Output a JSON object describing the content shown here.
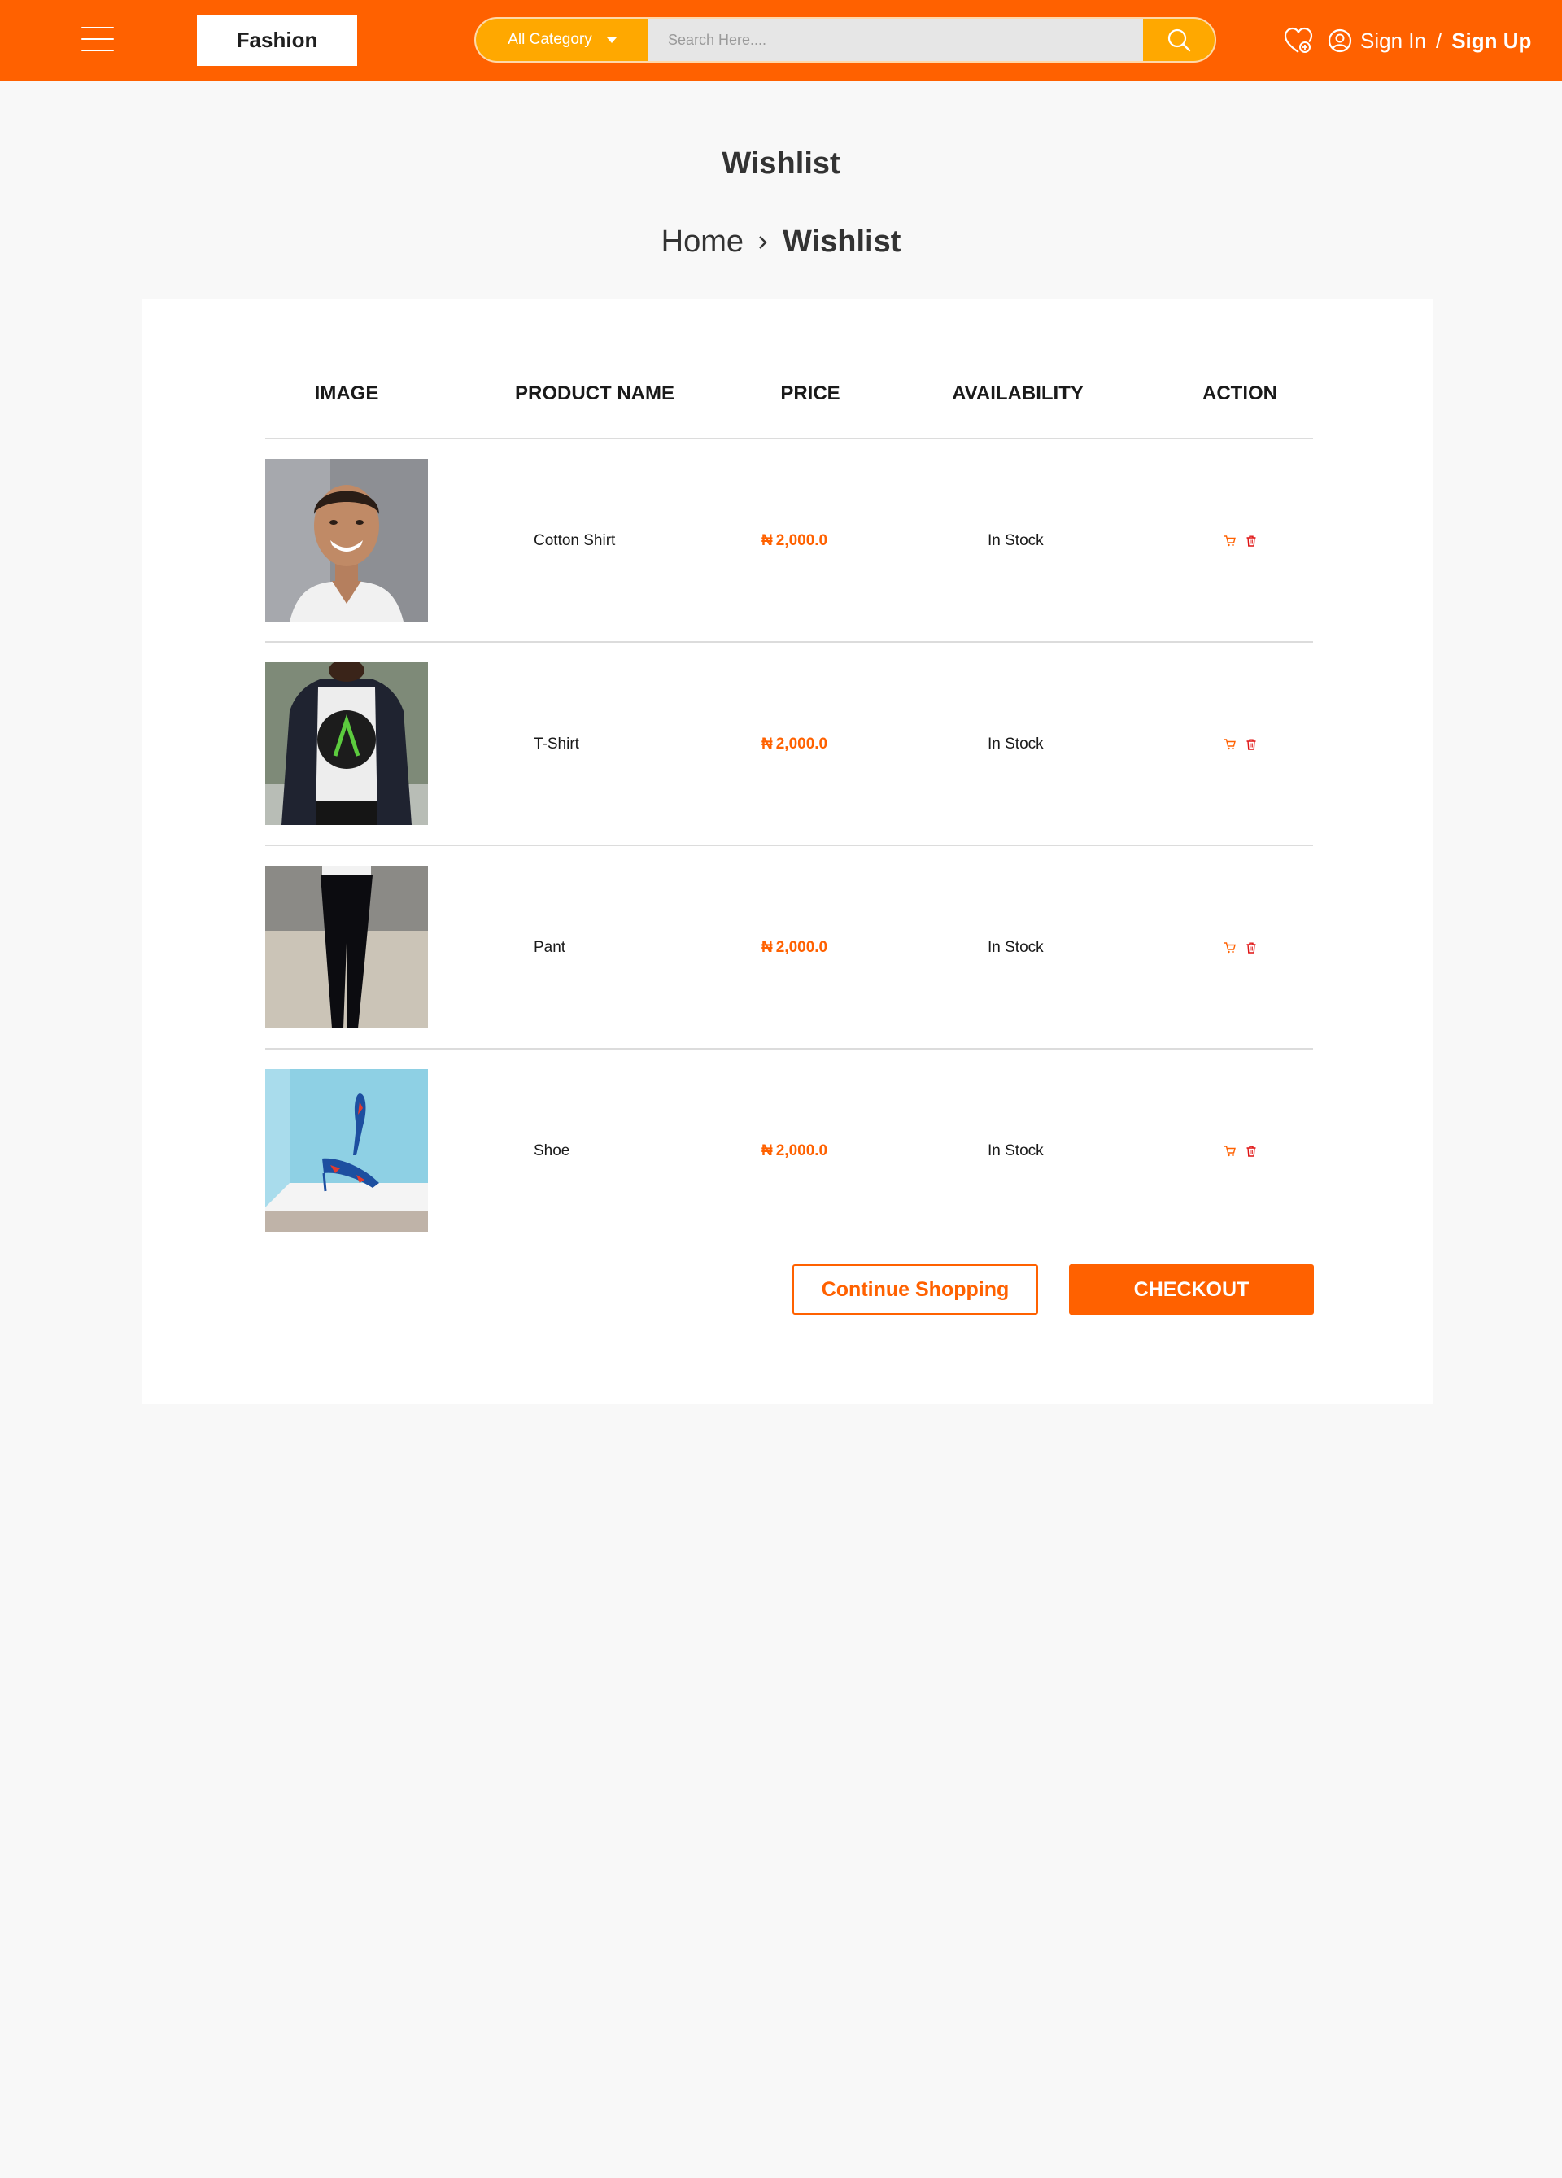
{
  "header": {
    "logo": "Fashion",
    "category": "All Category",
    "search_placeholder": "Search Here....",
    "sign_in": "Sign In",
    "slash": "/",
    "sign_up": "Sign Up",
    "brand_color": "#ff6100",
    "accent_color": "#ffa800"
  },
  "page": {
    "title": "Wishlist",
    "breadcrumb": {
      "home": "Home",
      "current": "Wishlist"
    }
  },
  "table": {
    "headers": [
      "IMAGE",
      "PRODUCT NAME",
      "PRICE",
      "AVAILABILITY",
      "ACTION"
    ],
    "rows": [
      {
        "name": "Cotton Shirt",
        "currency": "₦",
        "price": "2,000.0",
        "availability": "In Stock"
      },
      {
        "name": "T-Shirt",
        "currency": "₦",
        "price": "2,000.0",
        "availability": "In Stock"
      },
      {
        "name": "Pant",
        "currency": "₦",
        "price": "2,000.0",
        "availability": "In Stock"
      },
      {
        "name": "Shoe",
        "currency": "₦",
        "price": "2,000.0",
        "availability": "In Stock"
      }
    ]
  },
  "buttons": {
    "continue": "Continue Shopping",
    "checkout": "CHECKOUT"
  },
  "icons": {
    "menu": "hamburger-menu-icon",
    "search": "search-icon",
    "wishlist": "heart-icon",
    "user": "user-circle-icon",
    "cart": "cart-icon",
    "delete": "trash-icon"
  }
}
